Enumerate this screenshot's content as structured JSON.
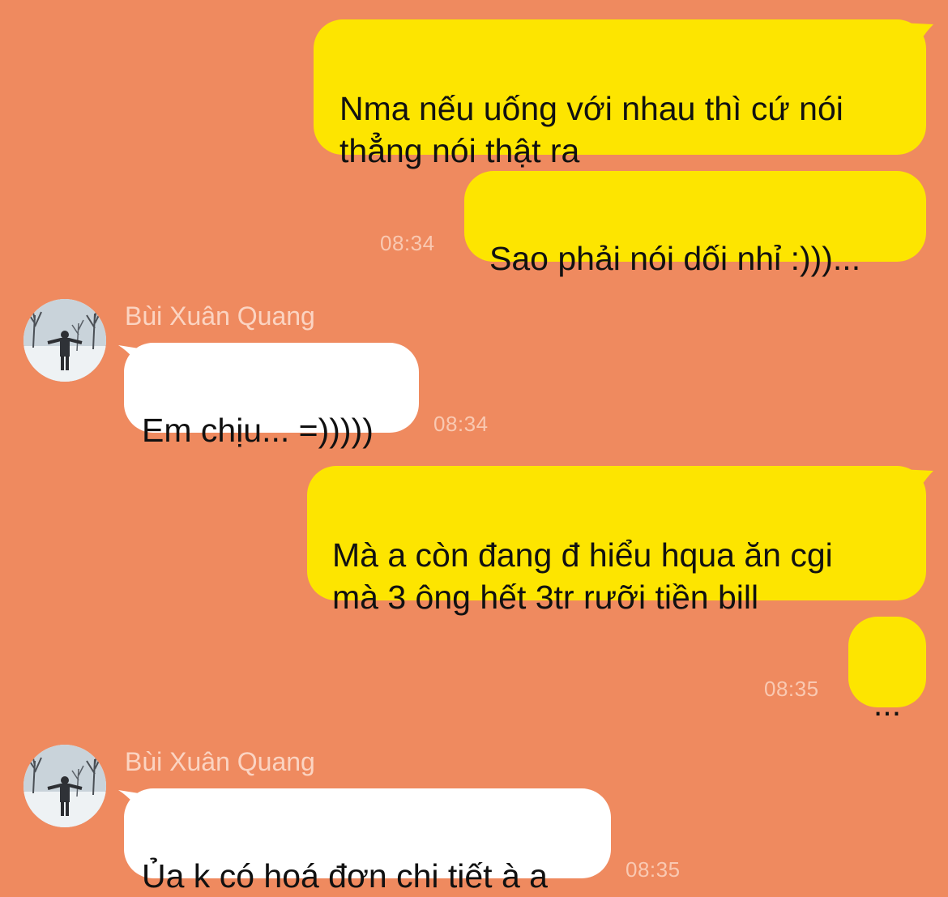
{
  "conversation": {
    "messages": [
      {
        "dir": "out",
        "text": "Nma nếu uống với nhau thì cứ nói\nthẳng nói thật ra",
        "time": ""
      },
      {
        "dir": "out",
        "text": "Sao phải nói dối nhỉ :)))...",
        "time": "08:34"
      },
      {
        "dir": "in",
        "sender": "Bùi Xuân Quang",
        "text": "Em chịu... =)))))",
        "time": "08:34"
      },
      {
        "dir": "out",
        "text": "Mà a còn đang đ hiểu hqua ăn cgi\nmà 3 ông hết 3tr rưỡi tiền bill",
        "time": ""
      },
      {
        "dir": "out",
        "text": "...",
        "time": "08:35"
      },
      {
        "dir": "in",
        "sender": "Bùi Xuân Quang",
        "text": "Ủa k có hoá đơn chi tiết à a",
        "time": "08:35"
      }
    ]
  },
  "colors": {
    "background": "#EF8A5F",
    "outgoing_bubble": "#FDE500",
    "incoming_bubble": "#FFFFFF",
    "timestamp": "#F9C9B2"
  }
}
